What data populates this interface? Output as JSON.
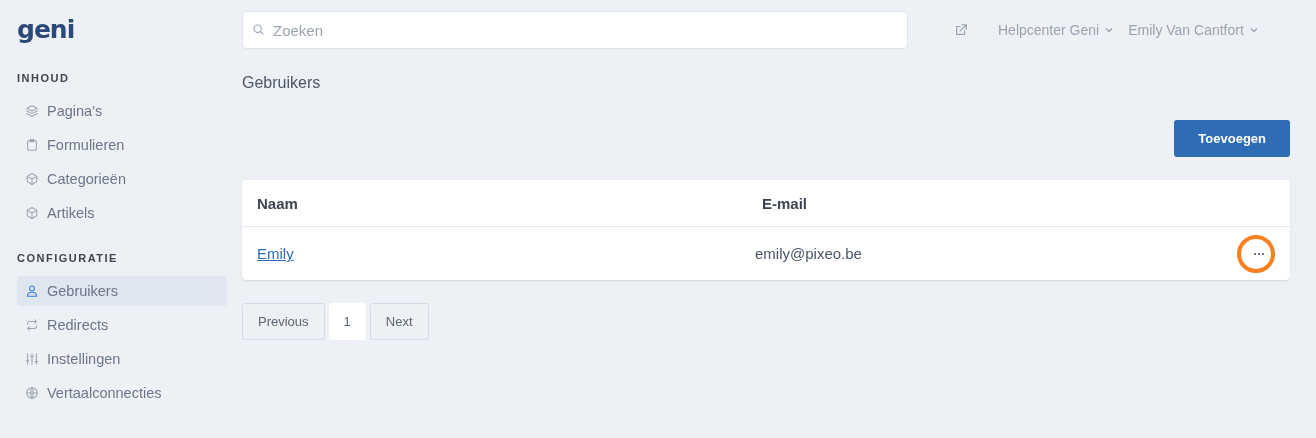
{
  "logo": "geni",
  "sidebar": {
    "sections": [
      {
        "heading": "INHOUD",
        "items": [
          {
            "label": "Pagina's",
            "selected": false
          },
          {
            "label": "Formulieren",
            "selected": false
          },
          {
            "label": "Categorieën",
            "selected": false
          },
          {
            "label": "Artikels",
            "selected": false
          }
        ]
      },
      {
        "heading": "CONFIGURATIE",
        "items": [
          {
            "label": "Gebruikers",
            "selected": true
          },
          {
            "label": "Redirects",
            "selected": false
          },
          {
            "label": "Instellingen",
            "selected": false
          },
          {
            "label": "Vertaalconnecties",
            "selected": false
          }
        ]
      }
    ]
  },
  "search": {
    "placeholder": "Zoeken"
  },
  "header_menus": [
    "Helpcenter Geni",
    "Emily Van Cantfort"
  ],
  "page_title": "Gebruikers",
  "add_button": "Toevoegen",
  "table": {
    "columns": [
      "Naam",
      "E-mail"
    ],
    "rows": [
      {
        "name": "Emily",
        "email": "emily@pixeo.be",
        "highlighted": true
      }
    ]
  },
  "pagination": {
    "previous": "Previous",
    "pages": [
      {
        "label": "1",
        "selected": true
      }
    ],
    "next": "Next"
  }
}
